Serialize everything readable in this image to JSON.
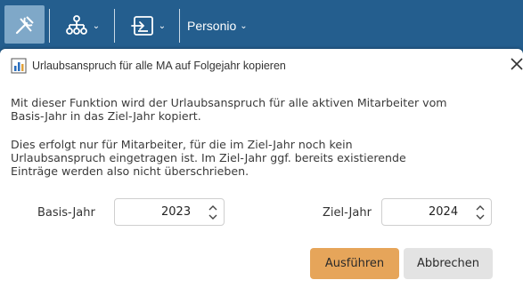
{
  "toolbar": {
    "items": [
      {
        "icon": "tools-icon",
        "active": true
      },
      {
        "icon": "org-tree-icon",
        "has_dropdown": true
      },
      {
        "icon": "import-icon",
        "has_dropdown": true
      }
    ],
    "menu_label": "Personio",
    "colors": {
      "background": "#245e8e",
      "active": "#7fa8c8"
    }
  },
  "dialog": {
    "icon": "chart-icon",
    "title": "Urlaubsanspruch für alle MA auf Folgejahr kopieren",
    "paragraph1_line1": "Mit dieser Funktion wird der Urlaubsanspruch für alle aktiven Mitarbeiter vom",
    "paragraph1_line2": "Basis-Jahr in das Ziel-Jahr kopiert.",
    "paragraph2_line1": "Dies erfolgt nur für Mitarbeiter, für die im Ziel-Jahr noch kein",
    "paragraph2_line2": "Urlaubsanspruch eingetragen ist. Im Ziel-Jahr ggf. bereits existierende",
    "paragraph2_line3": "Einträge werden also nicht überschrieben.",
    "base_year_label": "Basis-Jahr",
    "base_year_value": "2023",
    "target_year_label": "Ziel-Jahr",
    "target_year_value": "2024",
    "run_button": "Ausführen",
    "cancel_button": "Abbrechen",
    "colors": {
      "primary_button": "#e6a55a",
      "secondary_button": "#e3e3e3"
    }
  }
}
